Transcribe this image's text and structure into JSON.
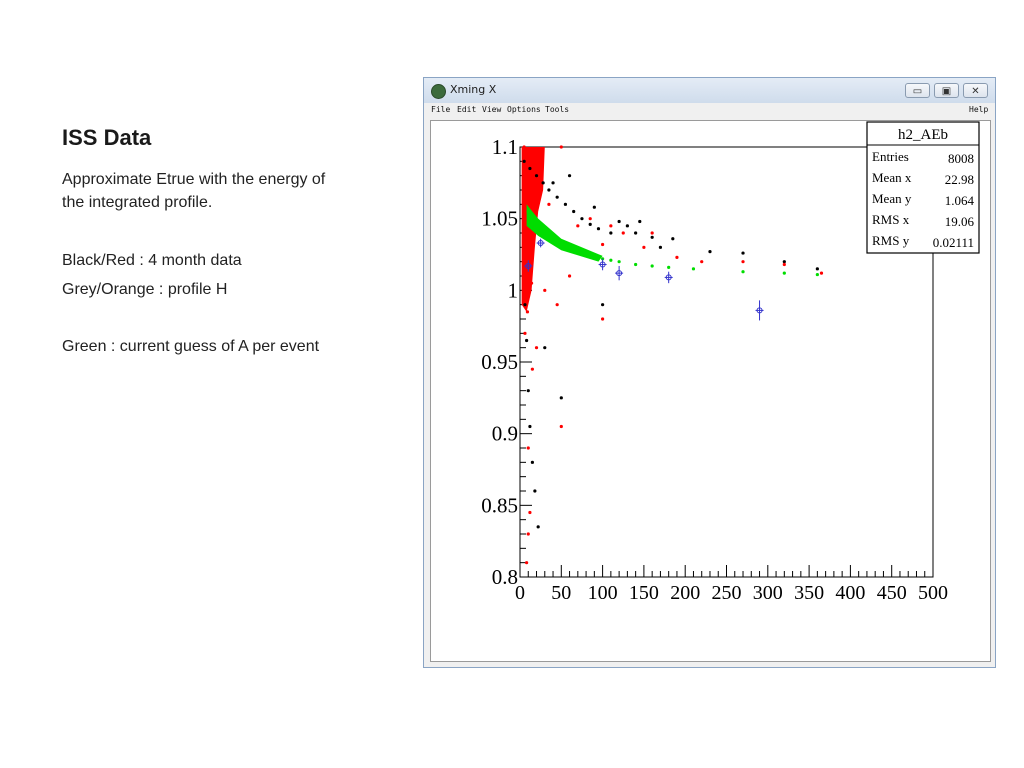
{
  "slide": {
    "title": "ISS Data",
    "line1": "Approximate Etrue with the energy of",
    "line2": "the integrated profile.",
    "line3": "Black/Red : 4 month data",
    "line4": "Grey/Orange : profile H",
    "line5": "Green : current guess of A per event"
  },
  "window": {
    "title": "Xming X",
    "buttons": {
      "minimize": "▭",
      "maximize": "▣",
      "close": "✕"
    }
  },
  "menu": {
    "file": "File",
    "edit": "Edit",
    "view": "View",
    "options": "Options",
    "tools": "Tools",
    "help": "Help"
  },
  "stats": {
    "name": "h2_AEb",
    "rows": [
      {
        "label": "Entries",
        "value": "8008"
      },
      {
        "label": "Mean x",
        "value": "22.98"
      },
      {
        "label": "Mean y",
        "value": "1.064"
      },
      {
        "label": "RMS x",
        "value": "19.06"
      },
      {
        "label": "RMS y",
        "value": "0.02111"
      }
    ]
  },
  "colors": {
    "black_series": "#000000",
    "red_series": "#ff0000",
    "green_series": "#00dd00",
    "profile": "#3333cc"
  },
  "chart_data": {
    "type": "scatter",
    "title": "",
    "xlabel": "",
    "ylabel": "",
    "xlim": [
      0,
      500
    ],
    "ylim": [
      0.8,
      1.1
    ],
    "x_ticks": [
      "0",
      "50",
      "100",
      "150",
      "200",
      "250",
      "300",
      "350",
      "400",
      "450",
      "500"
    ],
    "y_ticks": [
      "0.8",
      "0.85",
      "0.9",
      "0.95",
      "1",
      "1.05",
      "1.1"
    ],
    "grid": false,
    "series": [
      {
        "color": "black",
        "points": [
          [
            5,
            1.09
          ],
          [
            12,
            1.085
          ],
          [
            20,
            1.08
          ],
          [
            28,
            1.075
          ],
          [
            35,
            1.07
          ],
          [
            45,
            1.065
          ],
          [
            55,
            1.06
          ],
          [
            65,
            1.055
          ],
          [
            75,
            1.05
          ],
          [
            85,
            1.046
          ],
          [
            95,
            1.043
          ],
          [
            110,
            1.04
          ],
          [
            130,
            1.045
          ],
          [
            145,
            1.048
          ],
          [
            160,
            1.037
          ],
          [
            185,
            1.036
          ],
          [
            230,
            1.027
          ],
          [
            270,
            1.026
          ],
          [
            320,
            1.02
          ],
          [
            360,
            1.015
          ],
          [
            40,
            1.075
          ],
          [
            60,
            1.08
          ],
          [
            90,
            1.058
          ],
          [
            120,
            1.048
          ],
          [
            140,
            1.04
          ],
          [
            170,
            1.03
          ],
          [
            8,
            0.965
          ],
          [
            10,
            0.93
          ],
          [
            12,
            0.905
          ],
          [
            15,
            0.88
          ],
          [
            18,
            0.86
          ],
          [
            22,
            0.835
          ],
          [
            50,
            0.925
          ],
          [
            100,
            0.99
          ],
          [
            6,
            0.99
          ],
          [
            30,
            0.96
          ]
        ]
      },
      {
        "color": "red",
        "points": [
          [
            5,
            1.1
          ],
          [
            8,
            1.08
          ],
          [
            15,
            1.06
          ],
          [
            25,
            1.09
          ],
          [
            35,
            1.06
          ],
          [
            50,
            1.1
          ],
          [
            70,
            1.045
          ],
          [
            85,
            1.05
          ],
          [
            100,
            1.032
          ],
          [
            110,
            1.045
          ],
          [
            125,
            1.04
          ],
          [
            150,
            1.03
          ],
          [
            160,
            1.04
          ],
          [
            190,
            1.023
          ],
          [
            220,
            1.02
          ],
          [
            270,
            1.02
          ],
          [
            320,
            1.018
          ],
          [
            365,
            1.012
          ],
          [
            100,
            0.98
          ],
          [
            50,
            0.905
          ],
          [
            10,
            0.89
          ],
          [
            12,
            0.845
          ],
          [
            10,
            0.83
          ],
          [
            8,
            0.81
          ],
          [
            15,
            0.945
          ],
          [
            20,
            0.96
          ],
          [
            30,
            1.0
          ],
          [
            45,
            0.99
          ],
          [
            60,
            1.01
          ],
          [
            6,
            0.97
          ],
          [
            9,
            0.985
          ],
          [
            14,
            1.005
          ]
        ]
      },
      {
        "color": "green",
        "points": [
          [
            10,
            1.055
          ],
          [
            20,
            1.045
          ],
          [
            30,
            1.04
          ],
          [
            40,
            1.035
          ],
          [
            50,
            1.032
          ],
          [
            60,
            1.03
          ],
          [
            70,
            1.028
          ],
          [
            80,
            1.026
          ],
          [
            90,
            1.024
          ],
          [
            100,
            1.022
          ],
          [
            110,
            1.021
          ],
          [
            120,
            1.02
          ],
          [
            140,
            1.018
          ],
          [
            160,
            1.017
          ],
          [
            180,
            1.016
          ],
          [
            210,
            1.015
          ],
          [
            270,
            1.013
          ],
          [
            320,
            1.012
          ],
          [
            360,
            1.011
          ]
        ]
      },
      {
        "color": "blue",
        "name": "profile",
        "points": [
          [
            10,
            1.017
          ],
          [
            25,
            1.033
          ],
          [
            100,
            1.018
          ],
          [
            120,
            1.012
          ],
          [
            180,
            1.009
          ],
          [
            290,
            0.986
          ]
        ],
        "errors": [
          0.004,
          0.003,
          0.004,
          0.005,
          0.004,
          0.007
        ]
      }
    ],
    "stats_box": {
      "name": "h2_AEb",
      "entries": 8008,
      "mean_x": 22.98,
      "mean_y": 1.064,
      "rms_x": 19.06,
      "rms_y": 0.02111
    }
  }
}
